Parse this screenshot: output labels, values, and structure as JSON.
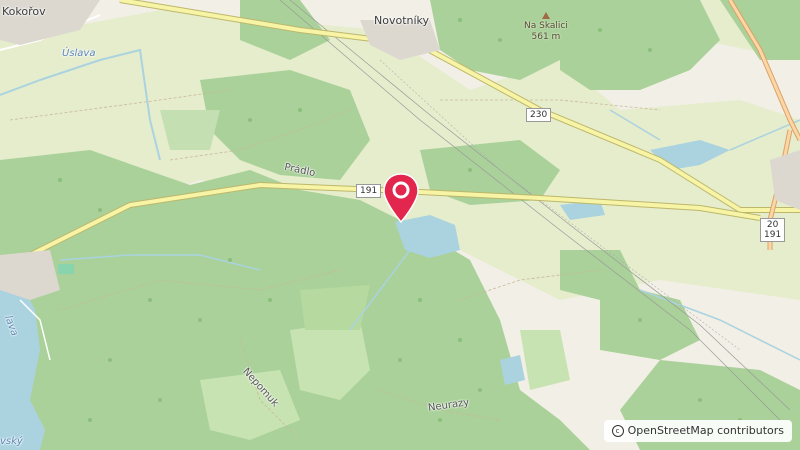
{
  "places": {
    "kokorov": "Kokořov",
    "novotniky": "Novotníky",
    "prado": "Prádlo",
    "nepomuk": "Nepomuk",
    "neurazy": "Neurazy"
  },
  "water": {
    "uslava": "Úslava",
    "lava": "lava",
    "vsky": "vský"
  },
  "peak": {
    "name": "Na Skalici",
    "elevation": "561 m"
  },
  "road_refs": {
    "r230": "230",
    "r191": "191",
    "r20": "20",
    "r191b": "191"
  },
  "attribution": {
    "symbol": "©",
    "text": "OpenStreetMap contributors"
  },
  "colors": {
    "forest": "#a9d199",
    "meadow": "#e6edcc",
    "background": "#f2efe6",
    "water": "#aad3df",
    "road": "#f7f4a6",
    "marker": "#e2264d"
  },
  "icons": {
    "marker": "map-pin-icon",
    "peak": "peak-triangle-icon"
  }
}
